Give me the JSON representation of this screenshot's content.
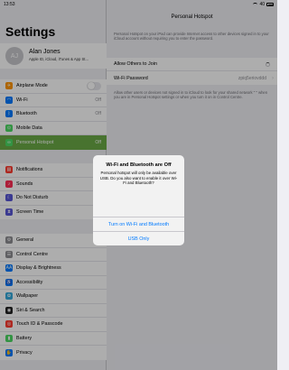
{
  "status": {
    "time": "13:53",
    "battery": "40"
  },
  "sidebar": {
    "title": "Settings",
    "profile": {
      "initials": "AJ",
      "name": "Alan Jones",
      "subtitle": "Apple ID, iCloud, iTunes & App St..."
    },
    "group1": [
      {
        "label": "Airplane Mode",
        "icon": "airplane-icon",
        "color": "#ff9500",
        "glyph": "✈",
        "toggle": true
      },
      {
        "label": "Wi-Fi",
        "icon": "wifi-icon",
        "color": "#007aff",
        "glyph": "◠",
        "value": "Off"
      },
      {
        "label": "Bluetooth",
        "icon": "bluetooth-icon",
        "color": "#007aff",
        "glyph": "ᛒ",
        "value": "Off"
      },
      {
        "label": "Mobile Data",
        "icon": "mobile-data-icon",
        "color": "#4cd964",
        "glyph": "⊙"
      },
      {
        "label": "Personal Hotspot",
        "icon": "hotspot-icon",
        "color": "#4cd964",
        "glyph": "∞",
        "value": "Off",
        "selected": true
      }
    ],
    "group2": [
      {
        "label": "Notifications",
        "icon": "notifications-icon",
        "color": "#ff3b30",
        "glyph": "▤"
      },
      {
        "label": "Sounds",
        "icon": "sounds-icon",
        "color": "#ff2d55",
        "glyph": "♪"
      },
      {
        "label": "Do Not Disturb",
        "icon": "moon-icon",
        "color": "#5856d6",
        "glyph": "☾"
      },
      {
        "label": "Screen Time",
        "icon": "hourglass-icon",
        "color": "#5856d6",
        "glyph": "⧗"
      }
    ],
    "group3": [
      {
        "label": "General",
        "icon": "gear-icon",
        "color": "#8e8e93",
        "glyph": "⚙"
      },
      {
        "label": "Control Centre",
        "icon": "control-centre-icon",
        "color": "#8e8e93",
        "glyph": "☰"
      },
      {
        "label": "Display & Brightness",
        "icon": "display-icon",
        "color": "#007aff",
        "glyph": "AA"
      },
      {
        "label": "Accessibility",
        "icon": "accessibility-icon",
        "color": "#007aff",
        "glyph": "♿"
      },
      {
        "label": "Wallpaper",
        "icon": "wallpaper-icon",
        "color": "#34aadc",
        "glyph": "✿"
      },
      {
        "label": "Siri & Search",
        "icon": "siri-icon",
        "color": "#222",
        "glyph": "◉"
      },
      {
        "label": "Touch ID & Passcode",
        "icon": "fingerprint-icon",
        "color": "#ff3b30",
        "glyph": "◎"
      },
      {
        "label": "Battery",
        "icon": "battery-icon",
        "color": "#4cd964",
        "glyph": "▮"
      },
      {
        "label": "Privacy",
        "icon": "privacy-icon",
        "color": "#007aff",
        "glyph": "✋"
      }
    ]
  },
  "main": {
    "title": "Personal Hotspot",
    "description": "Personal Hotspot on your iPad can provide Internet access to other devices signed in to your iCloud account without requiring you to enter the password.",
    "rows": {
      "allow_label": "Allow Others to Join",
      "password_label": "Wi-Fi Password",
      "password_value": "zpiq5eriovddd"
    },
    "footer": "Allow other users or devices not signed in to iCloud to look for your shared network \"          \" when you are in Personal Hotspot settings or when you turn it on in Control Centre."
  },
  "alert": {
    "title": "Wi-Fi and Bluetooth are Off",
    "message": "Personal hotspot will only be available over USB. Do you also want to enable it over Wi-Fi and Bluetooth?",
    "button_primary": "Turn on Wi-Fi and Bluetooth",
    "button_secondary": "USB Only"
  }
}
